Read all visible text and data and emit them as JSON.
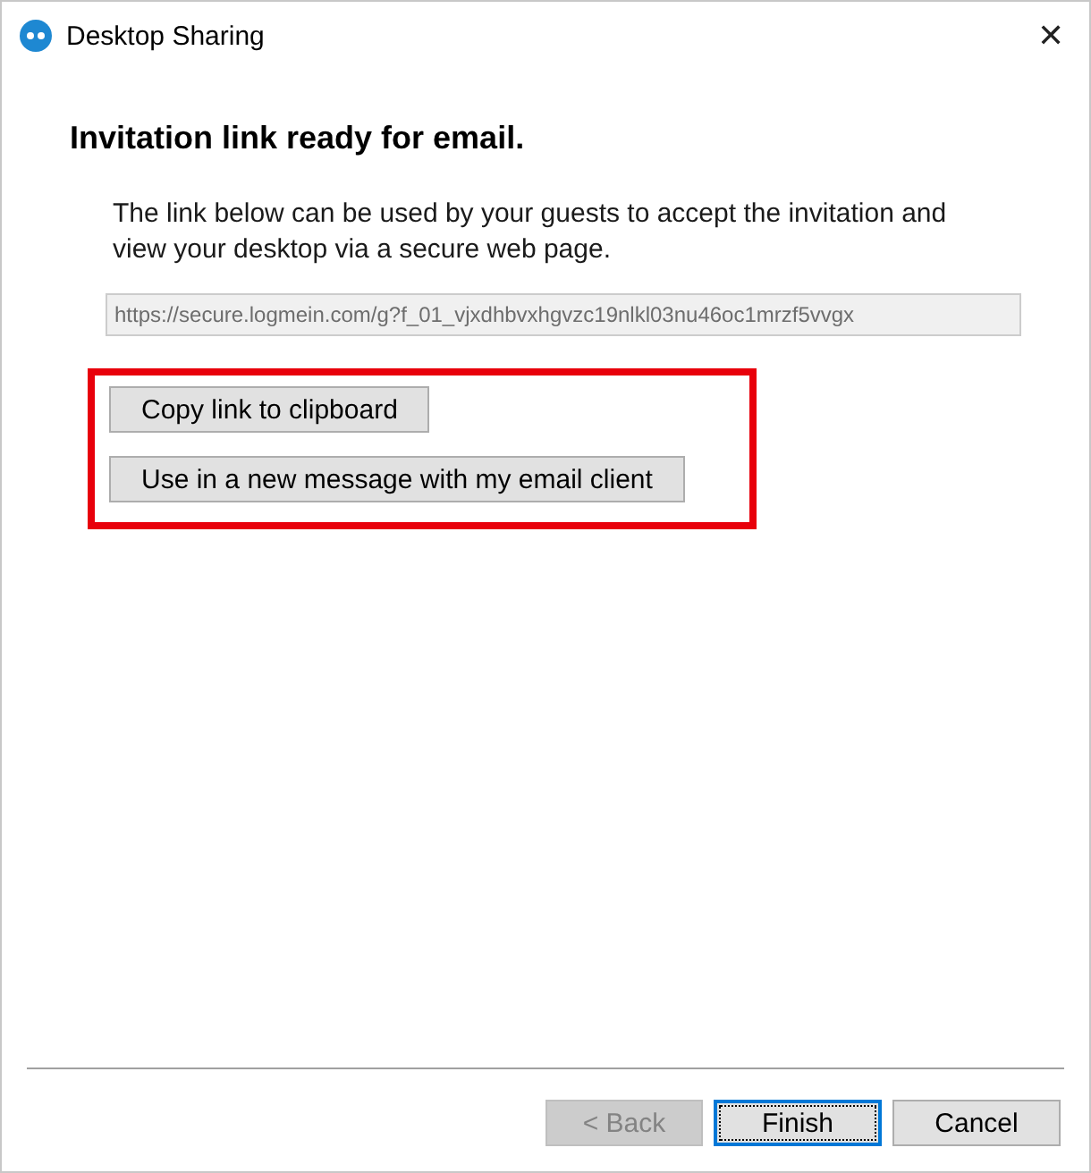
{
  "window": {
    "title": "Desktop Sharing",
    "close": "✕"
  },
  "heading": "Invitation link ready for email.",
  "description": "The link below can be used by your guests to accept the invitation and view your desktop via a secure web page.",
  "link_field": {
    "value": "https://secure.logmein.com/g?f_01_vjxdhbvxhgvzc19nlkl03nu46oc1mrzf5vvgx",
    "disabled": true
  },
  "actions": {
    "highlighted": true,
    "buttons": [
      {
        "label": "Copy link to clipboard"
      },
      {
        "label": "Use in a new message with my email client"
      }
    ]
  },
  "footer_buttons": [
    {
      "label": "< Back",
      "disabled": true,
      "default": false
    },
    {
      "label": "Finish",
      "disabled": false,
      "default": true
    },
    {
      "label": "Cancel",
      "disabled": false,
      "default": false
    }
  ]
}
